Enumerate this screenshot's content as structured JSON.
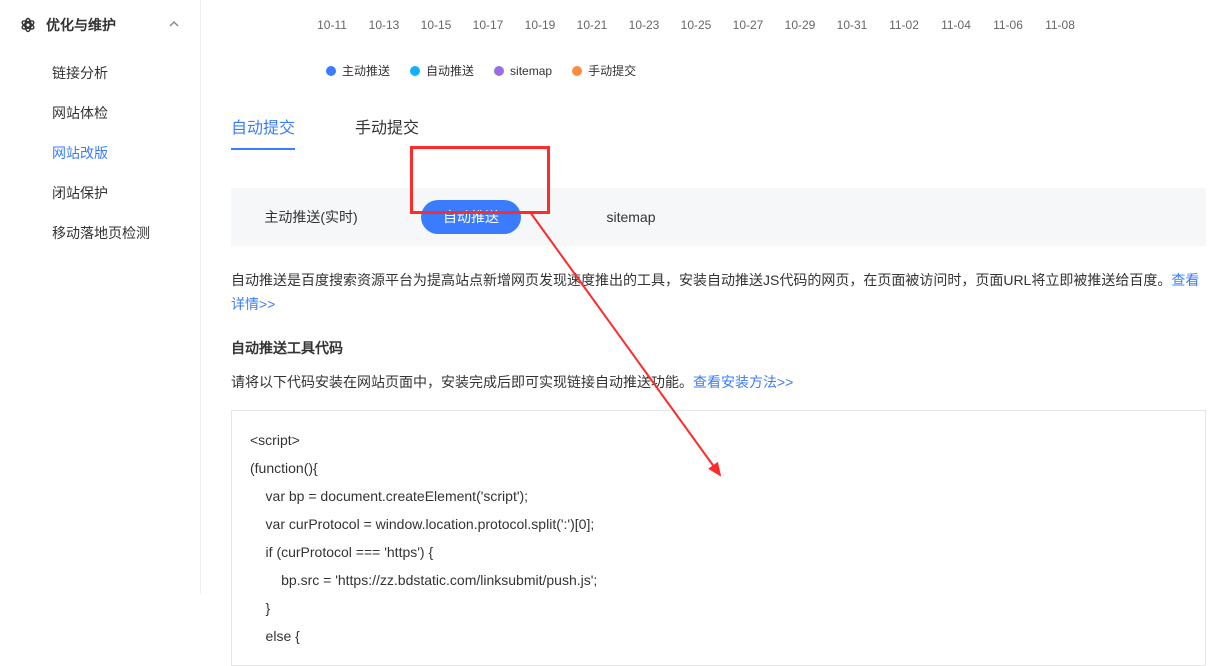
{
  "sidebar": {
    "group_title": "优化与维护",
    "items": [
      {
        "label": "链接分析",
        "active": false
      },
      {
        "label": "网站体检",
        "active": false
      },
      {
        "label": "网站改版",
        "active": true
      },
      {
        "label": "闭站保护",
        "active": false
      },
      {
        "label": "移动落地页检测",
        "active": false
      }
    ]
  },
  "xaxis": [
    "10-11",
    "10-13",
    "10-15",
    "10-17",
    "10-19",
    "10-21",
    "10-23",
    "10-25",
    "10-27",
    "10-29",
    "10-31",
    "11-02",
    "11-04",
    "11-06",
    "11-08"
  ],
  "legend": [
    {
      "label": "主动推送",
      "color": "blue"
    },
    {
      "label": "自动推送",
      "color": "cyan"
    },
    {
      "label": "sitemap",
      "color": "purple"
    },
    {
      "label": "手动提交",
      "color": "orange"
    }
  ],
  "tabs": [
    {
      "label": "自动提交",
      "active": true
    },
    {
      "label": "手动提交",
      "active": false
    }
  ],
  "methods": {
    "m1": "主动推送(实时)",
    "m2": "自动推送",
    "m3": "sitemap"
  },
  "desc_text": "自动推送是百度搜索资源平台为提高站点新增网页发现速度推出的工具，安装自动推送JS代码的网页，在页面被访问时，页面URL将立即被推送给百度。",
  "desc_link": "查看详情>>",
  "subtitle": "自动推送工具代码",
  "subdesc_text": "请将以下代码安装在网站页面中，安装完成后即可实现链接自动推送功能。",
  "subdesc_link": "查看安装方法>>",
  "code": "<script>\n(function(){\n    var bp = document.createElement('script');\n    var curProtocol = window.location.protocol.split(':')[0];\n    if (curProtocol === 'https') {\n        bp.src = 'https://zz.bdstatic.com/linksubmit/push.js';\n    }\n    else {"
}
